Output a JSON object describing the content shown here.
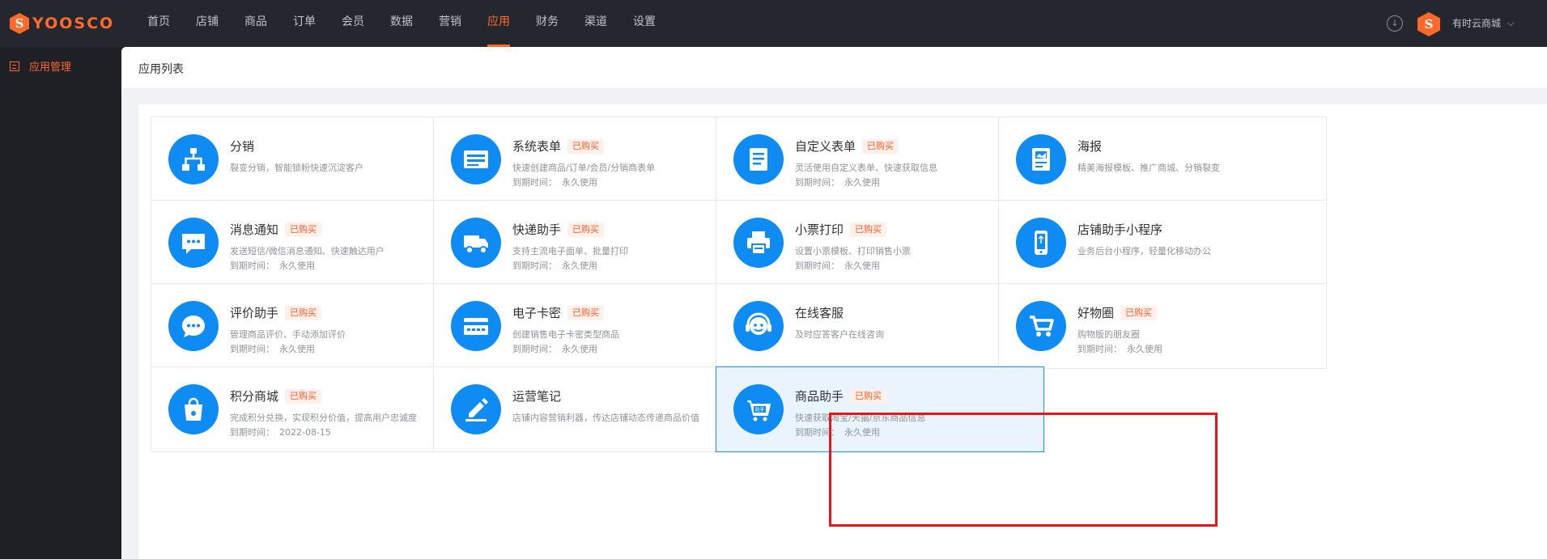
{
  "app": {
    "logo_text": "YOOSCO",
    "logo_mark": "S"
  },
  "nav": {
    "items": [
      "首页",
      "店铺",
      "商品",
      "订单",
      "会员",
      "数据",
      "营销",
      "应用",
      "财务",
      "渠道",
      "设置"
    ],
    "active": "应用"
  },
  "user": {
    "shop_name": "有时云商城",
    "avatar_letter": "S",
    "download_icon": "download-icon"
  },
  "sidebar": {
    "items": [
      {
        "label": "应用管理",
        "icon": "app-grid-icon",
        "active": true
      }
    ]
  },
  "page": {
    "title": "应用列表"
  },
  "expire_label": "到期时间：",
  "purchased_label": "已购买",
  "apps": [
    {
      "name": "分销",
      "icon": "org-chart-icon",
      "desc": "裂变分销，智能锁粉快速沉淀客户",
      "purchased": false,
      "expire": ""
    },
    {
      "name": "系统表单",
      "icon": "form-icon",
      "desc": "快速创建商品/订单/会员/分销商表单",
      "purchased": true,
      "expire": "永久使用"
    },
    {
      "name": "自定义表单",
      "icon": "document-icon",
      "desc": "灵活使用自定义表单、快速获取信息",
      "purchased": true,
      "expire": "永久使用"
    },
    {
      "name": "海报",
      "icon": "poster-icon",
      "desc": "精美海报模板、推广商城、分销裂变",
      "purchased": false,
      "expire": ""
    },
    {
      "name": "消息通知",
      "icon": "chat-bubble-icon",
      "desc": "发送短信/微信消息通知、快速触达用户",
      "purchased": true,
      "expire": "永久使用"
    },
    {
      "name": "快递助手",
      "icon": "truck-icon",
      "desc": "支持主流电子面单、批量打印",
      "purchased": true,
      "expire": "永久使用"
    },
    {
      "name": "小票打印",
      "icon": "printer-icon",
      "desc": "设置小票模板、打印销售小票",
      "purchased": true,
      "expire": "永久使用"
    },
    {
      "name": "店铺助手小程序",
      "icon": "phone-icon",
      "desc": "业务后台小程序，轻量化移动办公",
      "purchased": false,
      "expire": ""
    },
    {
      "name": "评价助手",
      "icon": "comment-icon",
      "desc": "管理商品评价、手动添加评价",
      "purchased": true,
      "expire": "永久使用"
    },
    {
      "name": "电子卡密",
      "icon": "card-icon",
      "desc": "创建销售电子卡密类型商品",
      "purchased": true,
      "expire": "永久使用"
    },
    {
      "name": "在线客服",
      "icon": "headset-icon",
      "desc": "及时应答客户在线咨询",
      "purchased": false,
      "expire": ""
    },
    {
      "name": "好物圈",
      "icon": "cart-icon",
      "desc": "购物版的朋友圈",
      "purchased": true,
      "expire": "永久使用"
    },
    {
      "name": "积分商城",
      "icon": "shopping-bag-icon",
      "desc": "完成积分兑换，实现积分价值，提高用户忠诚度",
      "purchased": true,
      "expire": "2022-08-15"
    },
    {
      "name": "运营笔记",
      "icon": "pen-icon",
      "desc": "店铺内容营销利器，传达店铺动态传递商品价值",
      "purchased": false,
      "expire": ""
    },
    {
      "name": "商品助手",
      "icon": "helper-cart-icon",
      "desc": "快速获取淘宝/天猫/京东商品信息",
      "purchased": true,
      "expire": "永久使用",
      "highlighted": true
    }
  ],
  "colors": {
    "accent": "#ff6a2b",
    "icon_bg": "#0f8cf3",
    "highlight_border": "#1890ff",
    "annotation_box": "#e8161c"
  }
}
